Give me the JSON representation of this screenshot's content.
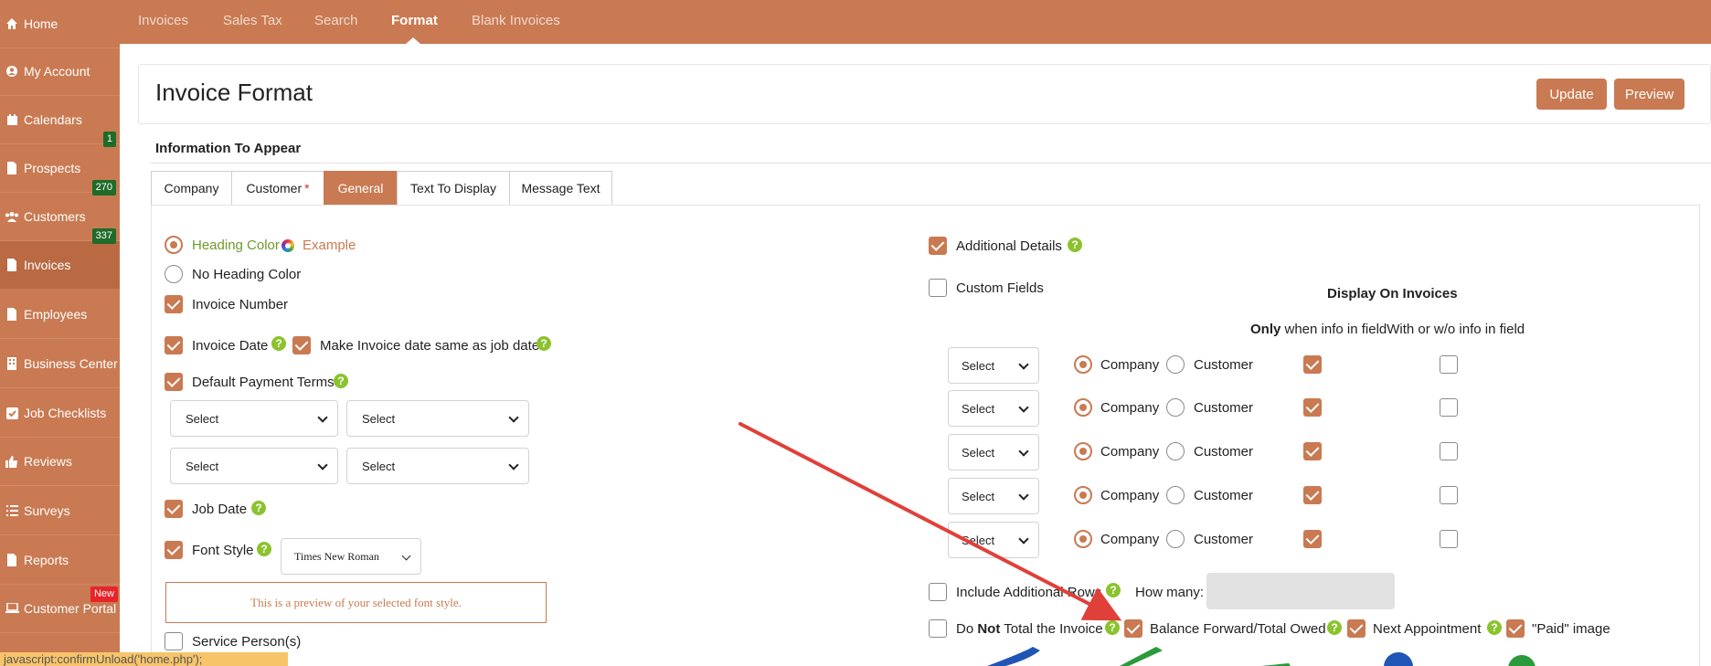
{
  "sidebar": {
    "items": [
      {
        "label": "Home",
        "icon": "home-icon"
      },
      {
        "label": "My Account",
        "icon": "user-circle-icon"
      },
      {
        "label": "Calendars",
        "icon": "calendar-icon"
      },
      {
        "label": "Prospects",
        "icon": "document-icon",
        "badge": "1"
      },
      {
        "label": "Customers",
        "icon": "users-icon",
        "badge": "270"
      },
      {
        "label": "Invoices",
        "icon": "document-icon",
        "badge": "337"
      },
      {
        "label": "Employees",
        "icon": "document-icon"
      },
      {
        "label": "Business Center",
        "icon": "building-icon"
      },
      {
        "label": "Job Checklists",
        "icon": "checkbox-icon"
      },
      {
        "label": "Reviews",
        "icon": "thumbs-up-icon"
      },
      {
        "label": "Surveys",
        "icon": "list-icon"
      },
      {
        "label": "Reports",
        "icon": "document-icon"
      },
      {
        "label": "Customer Portal",
        "icon": "laptop-icon",
        "badge": "New"
      }
    ]
  },
  "topnav": {
    "items": [
      "Invoices",
      "Sales Tax",
      "Search",
      "Format",
      "Blank Invoices"
    ],
    "active": "Format"
  },
  "header": {
    "title": "Invoice Format",
    "update_label": "Update",
    "preview_label": "Preview"
  },
  "section": {
    "title": "Information To Appear"
  },
  "tabs": [
    {
      "label": "Company"
    },
    {
      "label": "Customer",
      "required_mark": "*"
    },
    {
      "label": "General"
    },
    {
      "label": "Text To Display"
    },
    {
      "label": "Message Text"
    }
  ],
  "left": {
    "heading_color": "Heading Color",
    "example": "Example",
    "no_heading_color": "No Heading Color",
    "invoice_number": "Invoice Number",
    "invoice_date": "Invoice Date",
    "same_as_job_date": "Make Invoice date same as job date",
    "default_payment_terms": "Default Payment Terms",
    "select_placeholder": "Select",
    "job_date": "Job Date",
    "font_style": "Font Style",
    "font_value": "Times New Roman",
    "font_preview": "This is a preview of your selected font style.",
    "service_persons": "Service Person(s)"
  },
  "right": {
    "additional_details": "Additional Details",
    "custom_fields": "Custom Fields",
    "display_on_invoices": "Display On Invoices",
    "only_bold": "Only",
    "only_rest": " when info in field",
    "without_info": "With or w/o info in field",
    "company": "Company",
    "customer": "Customer",
    "include_additional_rows": "Include Additional Rows",
    "how_many": "How many:",
    "do_label": "Do ",
    "not_label": "Not",
    "total_invoice_label": " Total the Invoice",
    "balance_forward": "Balance Forward/Total Owed",
    "next_appointment": "Next Appointment",
    "paid_image": "\"Paid\" image"
  },
  "status_tip": "javascript:confirmUnload('home.php');",
  "colors": {
    "brand": "#c97a52",
    "help": "#8bc32e",
    "badge": "#1f6b2a",
    "new_badge": "#e8232a",
    "arrow": "#e0403a"
  }
}
